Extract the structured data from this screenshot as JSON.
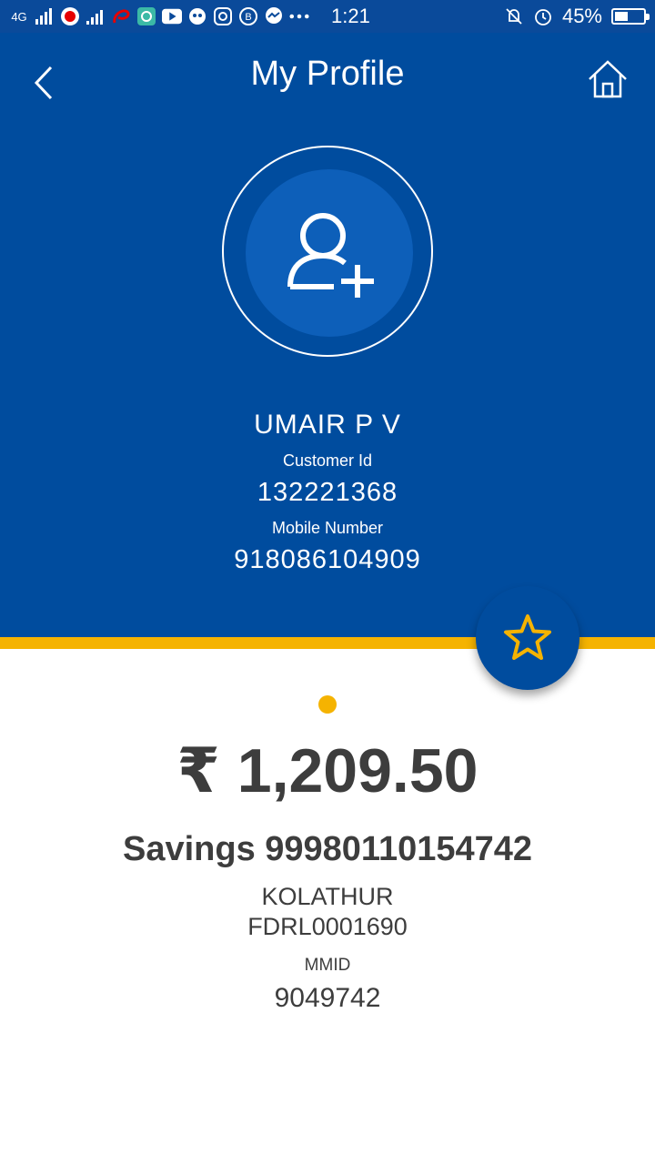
{
  "status_bar": {
    "network": "4G",
    "time": "1:21",
    "battery_percent": "45%",
    "battery_level": 0.45,
    "notification_icons": [
      "signal-icon",
      "vodafone-icon",
      "signal-icon",
      "airtel-icon",
      "chat-icon",
      "youtube-icon",
      "game-icon",
      "instagram-icon",
      "b-icon",
      "messenger-icon",
      "more-icon"
    ],
    "right_icons": [
      "mute-icon",
      "alarm-icon"
    ]
  },
  "header": {
    "title": "My Profile"
  },
  "profile": {
    "name": "UMAIR P V",
    "customer_id_label": "Customer Id",
    "customer_id": "132221368",
    "mobile_label": "Mobile Number",
    "mobile": "918086104909"
  },
  "account": {
    "balance": "₹ 1,209.50",
    "account_line": "Savings 99980110154742",
    "branch": "KOLATHUR",
    "ifsc": "FDRL0001690",
    "mmid_label": "MMID",
    "mmid": "9049742"
  },
  "colors": {
    "primary": "#004c9e",
    "accent": "#f5b301",
    "text_dark": "#3d3d3d"
  }
}
